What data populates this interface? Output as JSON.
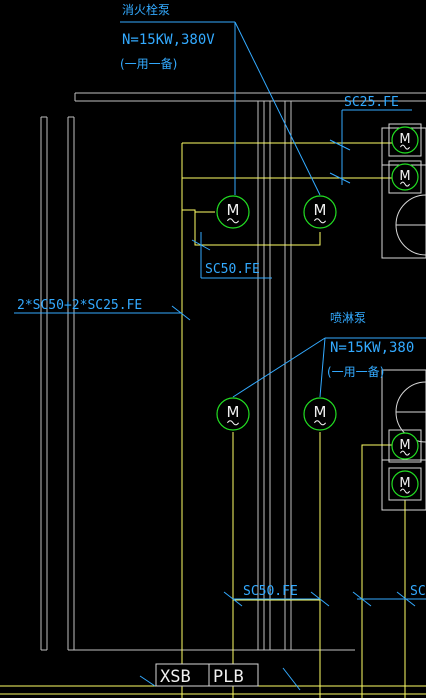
{
  "colors": {
    "background": "#000000",
    "wire": "#ffff66",
    "annotation": "#33aaff",
    "frame": "#bfbfbf",
    "motor": "#22dd22",
    "equipment": "#d8d8d8"
  },
  "labels": {
    "fire_hydrant_pump_title": "消火栓泵",
    "fire_hydrant_pump_rating": "N=15KW,380V",
    "fire_hydrant_pump_mode": "(一用一备)",
    "sprinkler_pump_title": "喷淋泵",
    "sprinkler_pump_rating": "N=15KW,380",
    "sprinkler_pump_mode": "(一用一备)",
    "conduit_top_right": "SC25.FE",
    "conduit_upper_motors": "SC50.FE",
    "conduit_left_trunk": "2*SC50+2*SC25.FE",
    "conduit_lower_motors": "SC50.FE",
    "conduit_bottom_right": "SC",
    "panel_xsb": "XSB",
    "panel_plb": "PLB"
  },
  "motors": [
    {
      "id": "motor-hydrant-1",
      "symbol": "M"
    },
    {
      "id": "motor-hydrant-2",
      "symbol": "M"
    },
    {
      "id": "motor-sprinkler-1",
      "symbol": "M"
    },
    {
      "id": "motor-sprinkler-2",
      "symbol": "M"
    },
    {
      "id": "motor-box-1",
      "symbol": "M"
    },
    {
      "id": "motor-box-2",
      "symbol": "M"
    },
    {
      "id": "motor-box-3",
      "symbol": "M"
    },
    {
      "id": "motor-box-4",
      "symbol": "M"
    }
  ]
}
